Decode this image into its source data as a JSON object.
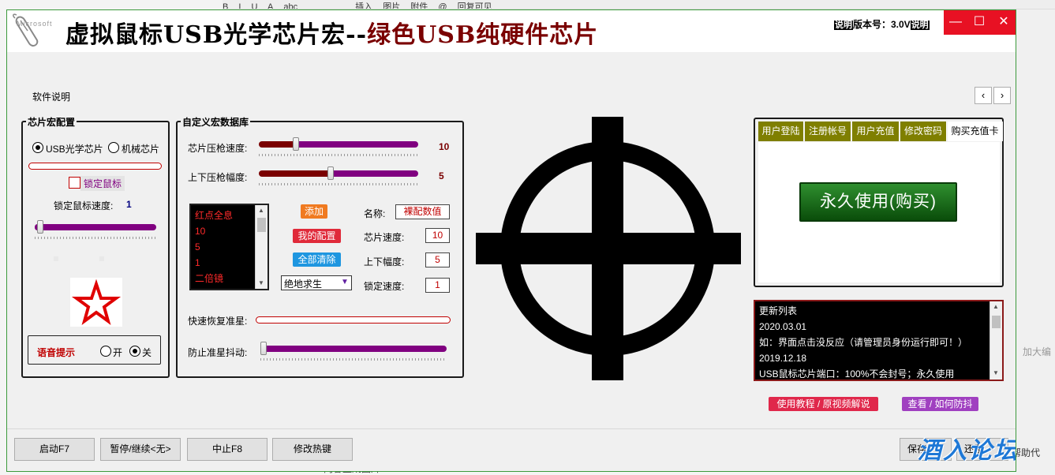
{
  "background": {
    "toolbar_items": [
      "B",
      "I",
      "U",
      "A",
      "abc",
      "",
      "",
      "",
      "",
      "",
      "插入",
      "图片",
      "附件",
      "@",
      "回复可见",
      "",
      "",
      "",
      "",
      ""
    ],
    "right_edge_text": "加大编",
    "right_edge_text2": "帮助代",
    "bottom_checkbox_text": "内容生成图片"
  },
  "app": {
    "logo_text": "Microsoft",
    "title_black": "虚拟鼠标USB光学芯片宏--",
    "title_red": "绿色USB纯硬件芯片",
    "version": {
      "left_tag": "说明",
      "label": "版本号：3.0V",
      "right_tag": "说明"
    },
    "window_controls": {
      "minimize": "—",
      "maximize": "☐",
      "close": "✕"
    },
    "menu": {
      "item": "软件说明",
      "nav_left": "‹",
      "nav_right": "›"
    }
  },
  "chip_config": {
    "title": "芯片宏配置",
    "radio_usb": "USB光学芯片",
    "radio_mech": "机械芯片",
    "radio_usb_selected": true,
    "lock_mouse_label": "锁定鼠标",
    "lock_speed_label": "锁定鼠标速度:",
    "lock_speed_value": "1",
    "lock_speed_level": 0.02,
    "voice": {
      "label": "语音提示",
      "on": "开",
      "off": "关",
      "on_selected": false,
      "off_selected": true
    }
  },
  "macro_db": {
    "title": "自定义宏数据库",
    "slider1": {
      "label": "芯片压枪速度:",
      "value": "10",
      "level": 0.22
    },
    "slider2": {
      "label": "上下压枪幅度:",
      "value": "5",
      "level": 0.45
    },
    "list_items": [
      "红点全息",
      "10",
      "5",
      "1",
      "二倍镜"
    ],
    "add_button": "添加",
    "my_config_button": "我的配置",
    "clear_all_button": "全部清除",
    "game_select": "绝地求生",
    "name_label": "名称:",
    "name_value": "裸配数值",
    "chip_speed_label": "芯片速度:",
    "chip_speed_value": "10",
    "range_label": "上下幅度:",
    "range_value": "5",
    "lock_speed_label": "锁定速度:",
    "lock_speed_value": "1",
    "quick_recover_label": "快速恢复准星:",
    "anti_shake_label": "防止准星抖动:",
    "anti_shake_level": 0.0
  },
  "account": {
    "tabs": [
      "用户登陆",
      "注册帐号",
      "用户充值",
      "修改密码",
      "购买充值卡"
    ],
    "active_tab": 4,
    "buy_button": "永久使用(购买)"
  },
  "updates": {
    "lines": [
      "更新列表",
      "2020.03.01",
      "如：界面点击没反应（请管理员身份运行即可！）",
      "2019.12.18",
      "USB鼠标芯片端口：100%不会封号；永久使用"
    ]
  },
  "links": {
    "tutorial": "使用教程 / 原视频解说",
    "anti_shake": "查看 / 如何防抖"
  },
  "bottom_bar": {
    "start": "启动F7",
    "pause": "暂停/继续<无>",
    "stop": "中止F8",
    "hotkey": "修改热键",
    "save": "保存",
    "restore": "还原",
    "watermark": "酒入论坛"
  },
  "colors": {
    "window_border": "#3c9a3c",
    "close_red": "#e81123",
    "slider_dark": "#7a0000",
    "slider_purple": "#800080",
    "tab_olive": "#7f7f00",
    "buy_green": "#0f5d0f",
    "value_red": "#c00000",
    "link_pink": "#e0284b",
    "link_purple": "#a040c0",
    "watermark_blue": "#1e78d6"
  }
}
